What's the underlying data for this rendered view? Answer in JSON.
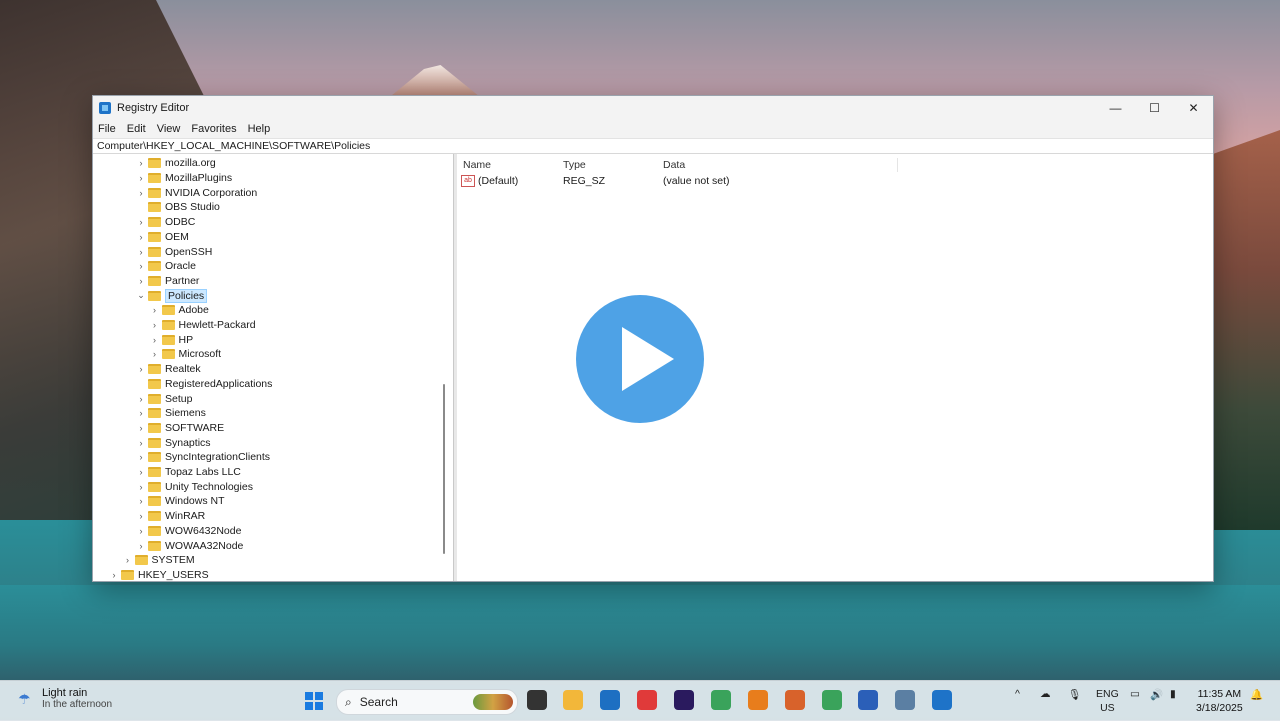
{
  "window": {
    "title": "Registry Editor",
    "controls": {
      "minimize": "—",
      "maximize": "☐",
      "close": "✕"
    }
  },
  "menu": [
    "File",
    "Edit",
    "View",
    "Favorites",
    "Help"
  ],
  "address": "Computer\\HKEY_LOCAL_MACHINE\\SOFTWARE\\Policies",
  "tree": [
    {
      "label": "mozilla.org",
      "depth": 2,
      "expander": ">"
    },
    {
      "label": "MozillaPlugins",
      "depth": 2,
      "expander": ">"
    },
    {
      "label": "NVIDIA Corporation",
      "depth": 2,
      "expander": ">"
    },
    {
      "label": "OBS Studio",
      "depth": 2,
      "expander": ""
    },
    {
      "label": "ODBC",
      "depth": 2,
      "expander": ">"
    },
    {
      "label": "OEM",
      "depth": 2,
      "expander": ">"
    },
    {
      "label": "OpenSSH",
      "depth": 2,
      "expander": ">"
    },
    {
      "label": "Oracle",
      "depth": 2,
      "expander": ">"
    },
    {
      "label": "Partner",
      "depth": 2,
      "expander": ">"
    },
    {
      "label": "Policies",
      "depth": 2,
      "expander": "v",
      "selected": true
    },
    {
      "label": "Adobe",
      "depth": 3,
      "expander": ">"
    },
    {
      "label": "Hewlett-Packard",
      "depth": 3,
      "expander": ">"
    },
    {
      "label": "HP",
      "depth": 3,
      "expander": ">"
    },
    {
      "label": "Microsoft",
      "depth": 3,
      "expander": ">"
    },
    {
      "label": "Realtek",
      "depth": 2,
      "expander": ">"
    },
    {
      "label": "RegisteredApplications",
      "depth": 2,
      "expander": ""
    },
    {
      "label": "Setup",
      "depth": 2,
      "expander": ">"
    },
    {
      "label": "Siemens",
      "depth": 2,
      "expander": ">"
    },
    {
      "label": "SOFTWARE",
      "depth": 2,
      "expander": ">"
    },
    {
      "label": "Synaptics",
      "depth": 2,
      "expander": ">"
    },
    {
      "label": "SyncIntegrationClients",
      "depth": 2,
      "expander": ">"
    },
    {
      "label": "Topaz Labs LLC",
      "depth": 2,
      "expander": ">"
    },
    {
      "label": "Unity Technologies",
      "depth": 2,
      "expander": ">"
    },
    {
      "label": "Windows NT",
      "depth": 2,
      "expander": ">"
    },
    {
      "label": "WinRAR",
      "depth": 2,
      "expander": ">"
    },
    {
      "label": "WOW6432Node",
      "depth": 2,
      "expander": ">"
    },
    {
      "label": "WOWAA32Node",
      "depth": 2,
      "expander": ">"
    },
    {
      "label": "SYSTEM",
      "depth": 1,
      "expander": ">"
    },
    {
      "label": "HKEY_USERS",
      "depth": 0,
      "expander": ">"
    }
  ],
  "values_pane": {
    "headers": {
      "name": "Name",
      "type": "Type",
      "data": "Data"
    },
    "rows": [
      {
        "icon": "ab",
        "name": "(Default)",
        "type": "REG_SZ",
        "data": "(value not set)"
      }
    ]
  },
  "taskbar": {
    "weather": {
      "title": "Light rain",
      "subtitle": "In the afternoon"
    },
    "search_label": "Search",
    "apps": [
      {
        "name": "task-view",
        "color": "#333333"
      },
      {
        "name": "file-explorer",
        "color": "#f2b73a"
      },
      {
        "name": "store",
        "color": "#1d6fc2"
      },
      {
        "name": "app-red",
        "color": "#e03a3a"
      },
      {
        "name": "premiere",
        "color": "#2a1a5e"
      },
      {
        "name": "chrome",
        "color": "#3aa35b"
      },
      {
        "name": "blender",
        "color": "#e87d1c"
      },
      {
        "name": "matlab",
        "color": "#d8622b"
      },
      {
        "name": "chrome-profile",
        "color": "#3aa35b"
      },
      {
        "name": "word",
        "color": "#2b5fb8"
      },
      {
        "name": "snipping",
        "color": "#5b7fa3"
      },
      {
        "name": "regedit",
        "color": "#1e73c8"
      }
    ],
    "tray": {
      "chevron": "^",
      "lang_top": "ENG",
      "lang_bottom": "US"
    },
    "clock": {
      "time": "11:35 AM",
      "date": "3/18/2025"
    }
  }
}
